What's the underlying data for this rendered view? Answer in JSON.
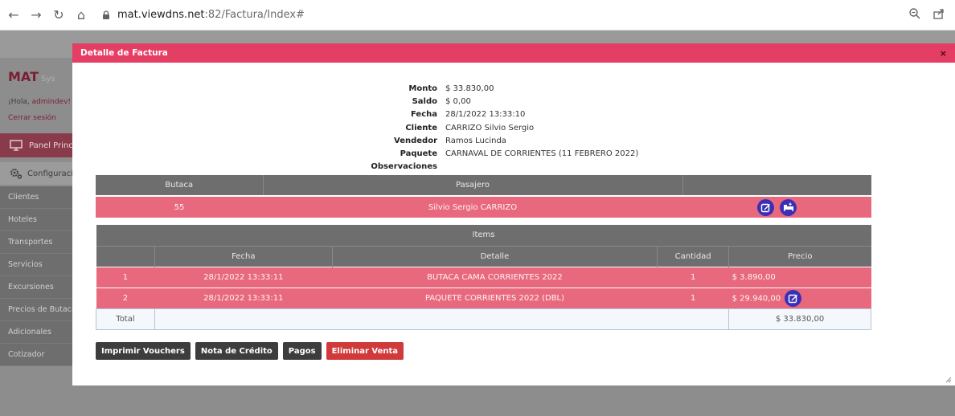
{
  "browser": {
    "url_host": "mat.viewdns.net",
    "url_path": ":82/Factura/Index#"
  },
  "app": {
    "brand_main": "MAT",
    "brand_sub": "Sys",
    "greeting_prefix": "¡Hola, ",
    "greeting_user": "admindev!",
    "logout": "Cerrar sesión",
    "panel": "Panel Principal",
    "config": "Configuración",
    "menu": [
      "Clientes",
      "Hoteles",
      "Transportes",
      "Servicios",
      "Excursiones",
      "Precios de Butacas",
      "Adicionales",
      "Cotizador"
    ]
  },
  "modal": {
    "title": "Detalle de Factura",
    "close": "×",
    "info": [
      {
        "label": "Monto",
        "value": "$ 33.830,00"
      },
      {
        "label": "Saldo",
        "value": "$ 0,00"
      },
      {
        "label": "Fecha",
        "value": "28/1/2022 13:33:10"
      },
      {
        "label": "Cliente",
        "value": "CARRIZO Silvio Sergio"
      },
      {
        "label": "Vendedor",
        "value": "Ramos Lucinda"
      },
      {
        "label": "Paquete",
        "value": "CARNAVAL DE CORRIENTES (11 FEBRERO 2022)"
      },
      {
        "label": "Observaciones",
        "value": ""
      }
    ],
    "passengers": {
      "headers": [
        "Butaca",
        "Pasajero",
        ""
      ],
      "rows": [
        {
          "butaca": "55",
          "pasajero": "Silvio Sergio CARRIZO"
        }
      ]
    },
    "items": {
      "title": "Items",
      "headers": [
        "",
        "Fecha",
        "Detalle",
        "Cantidad",
        "Precio"
      ],
      "rows": [
        {
          "n": "1",
          "fecha": "28/1/2022 13:33:11",
          "detalle": "BUTACA CAMA CORRIENTES 2022",
          "cantidad": "1",
          "precio": "$ 3.890,00"
        },
        {
          "n": "2",
          "fecha": "28/1/2022 13:33:11",
          "detalle": "PAQUETE CORRIENTES 2022 (DBL)",
          "cantidad": "1",
          "precio": "$ 29.940,00"
        }
      ],
      "total_label": "Total",
      "total_value": "$ 33.830,00"
    },
    "buttons": {
      "vouchers": "Imprimir Vouchers",
      "credit_note": "Nota de Crédito",
      "payments": "Pagos",
      "delete_sale": "Eliminar Venta"
    }
  },
  "colors": {
    "accent": "#e53e64",
    "row_pink": "#e8697e",
    "header_gray": "#6e6e6e",
    "icon_blue": "#3b2fb5",
    "danger": "#d03a3a"
  }
}
